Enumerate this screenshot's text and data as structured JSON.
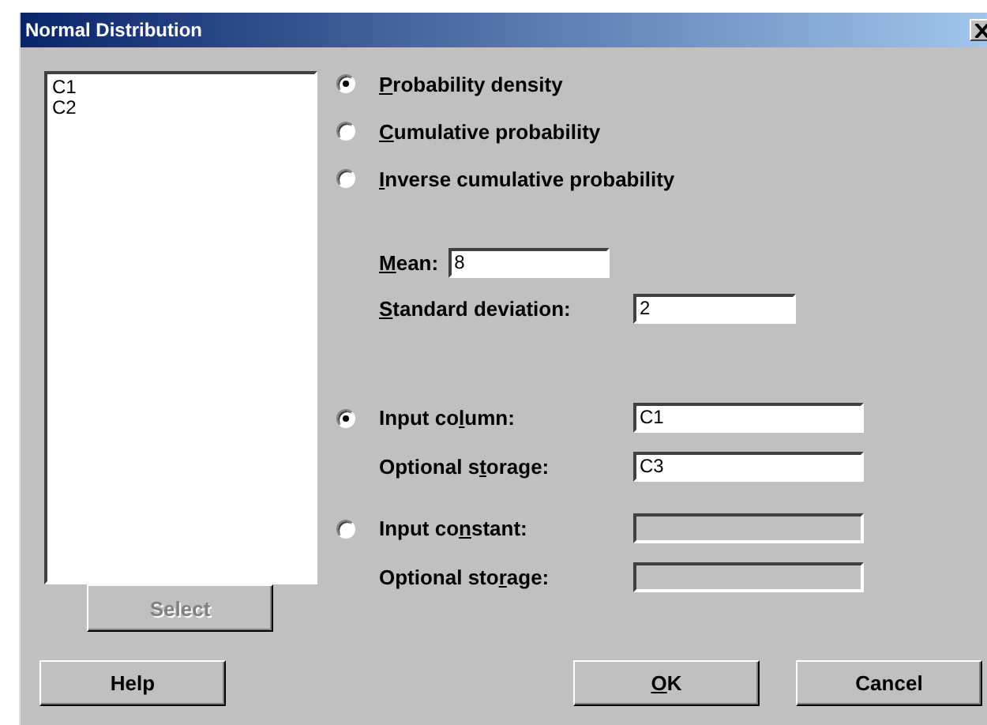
{
  "window": {
    "title": "Normal Distribution"
  },
  "variables": [
    "C1",
    "C2"
  ],
  "select_button": {
    "label": "Select",
    "disabled": true
  },
  "distribution_options": [
    {
      "key": "P",
      "after": "robability density",
      "selected": true
    },
    {
      "key": "C",
      "after": "umulative probability",
      "selected": false
    },
    {
      "key": "I",
      "after": "nverse cumulative probability",
      "selected": false
    }
  ],
  "mean": {
    "key": "M",
    "after": "ean:",
    "value": "8"
  },
  "standard_deviation": {
    "key": "S",
    "after": "tandard deviation:",
    "value": "2"
  },
  "input_options": [
    {
      "before": "Input co",
      "key": "l",
      "after": "umn:",
      "selected": true,
      "disabled": false,
      "value": "C1",
      "storage": {
        "before": "Optional s",
        "key": "t",
        "after": "orage:",
        "value": "C3"
      }
    },
    {
      "before": "Input co",
      "key": "n",
      "after": "stant:",
      "selected": false,
      "disabled": true,
      "storage": {
        "before": "Optional sto",
        "key": "r",
        "after": "age:"
      }
    }
  ],
  "buttons": [
    {
      "before": "Help"
    },
    {
      "key": "O",
      "after": "K"
    },
    {
      "before": "Cancel"
    }
  ]
}
